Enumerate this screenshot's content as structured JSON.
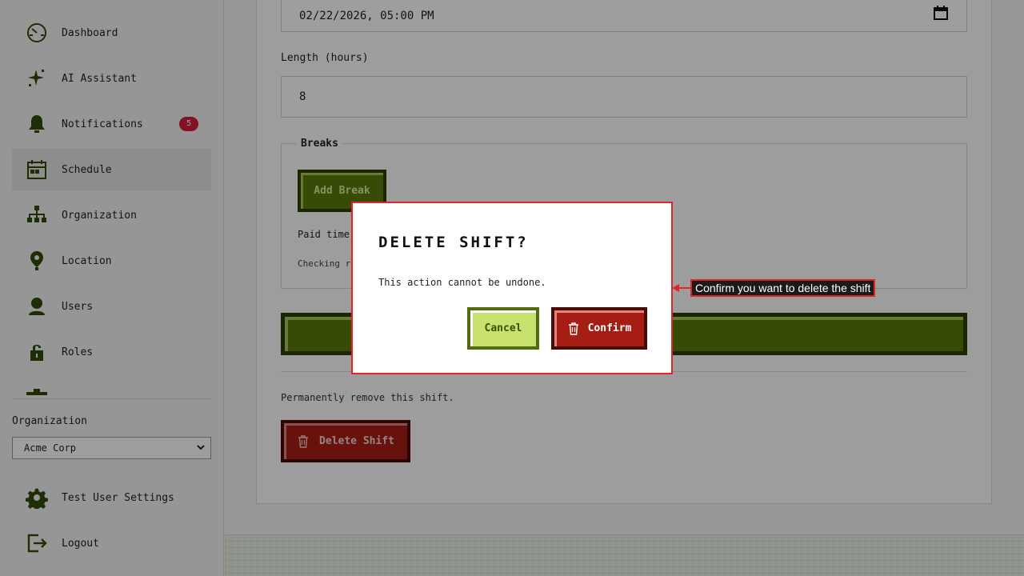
{
  "sidebar": {
    "items": [
      {
        "label": "Dashboard",
        "icon": "dashboard-icon"
      },
      {
        "label": "AI Assistant",
        "icon": "sparkle-icon"
      },
      {
        "label": "Notifications",
        "icon": "bell-icon",
        "badge": "5"
      },
      {
        "label": "Schedule",
        "icon": "calendar-icon",
        "active": true
      },
      {
        "label": "Organization",
        "icon": "org-chart-icon"
      },
      {
        "label": "Location",
        "icon": "location-pin-icon"
      },
      {
        "label": "Users",
        "icon": "user-icon"
      },
      {
        "label": "Roles",
        "icon": "lock-icon"
      }
    ],
    "org_label": "Organization",
    "org_selected": "Acme Corp",
    "settings_label": "Test User Settings",
    "logout_label": "Logout"
  },
  "form": {
    "datetime_value": "02/22/2026, 05:00 PM",
    "length_label": "Length (hours)",
    "length_value": "8",
    "breaks_legend": "Breaks",
    "add_break_label": "Add Break",
    "paid_time_label": "Paid time:",
    "checking_text": "Checking re",
    "remove_text": "Permanently remove this shift.",
    "delete_shift_label": "Delete Shift"
  },
  "modal": {
    "title": "DELETE SHIFT?",
    "message": "This action cannot be undone.",
    "cancel_label": "Cancel",
    "confirm_label": "Confirm"
  },
  "tooltip": {
    "text": "Confirm you want to delete the shift"
  },
  "colors": {
    "accent_green": "#5a7a0c",
    "danger_red": "#a61d14",
    "badge_red": "#d0203a",
    "highlight_red": "#e0252a"
  }
}
